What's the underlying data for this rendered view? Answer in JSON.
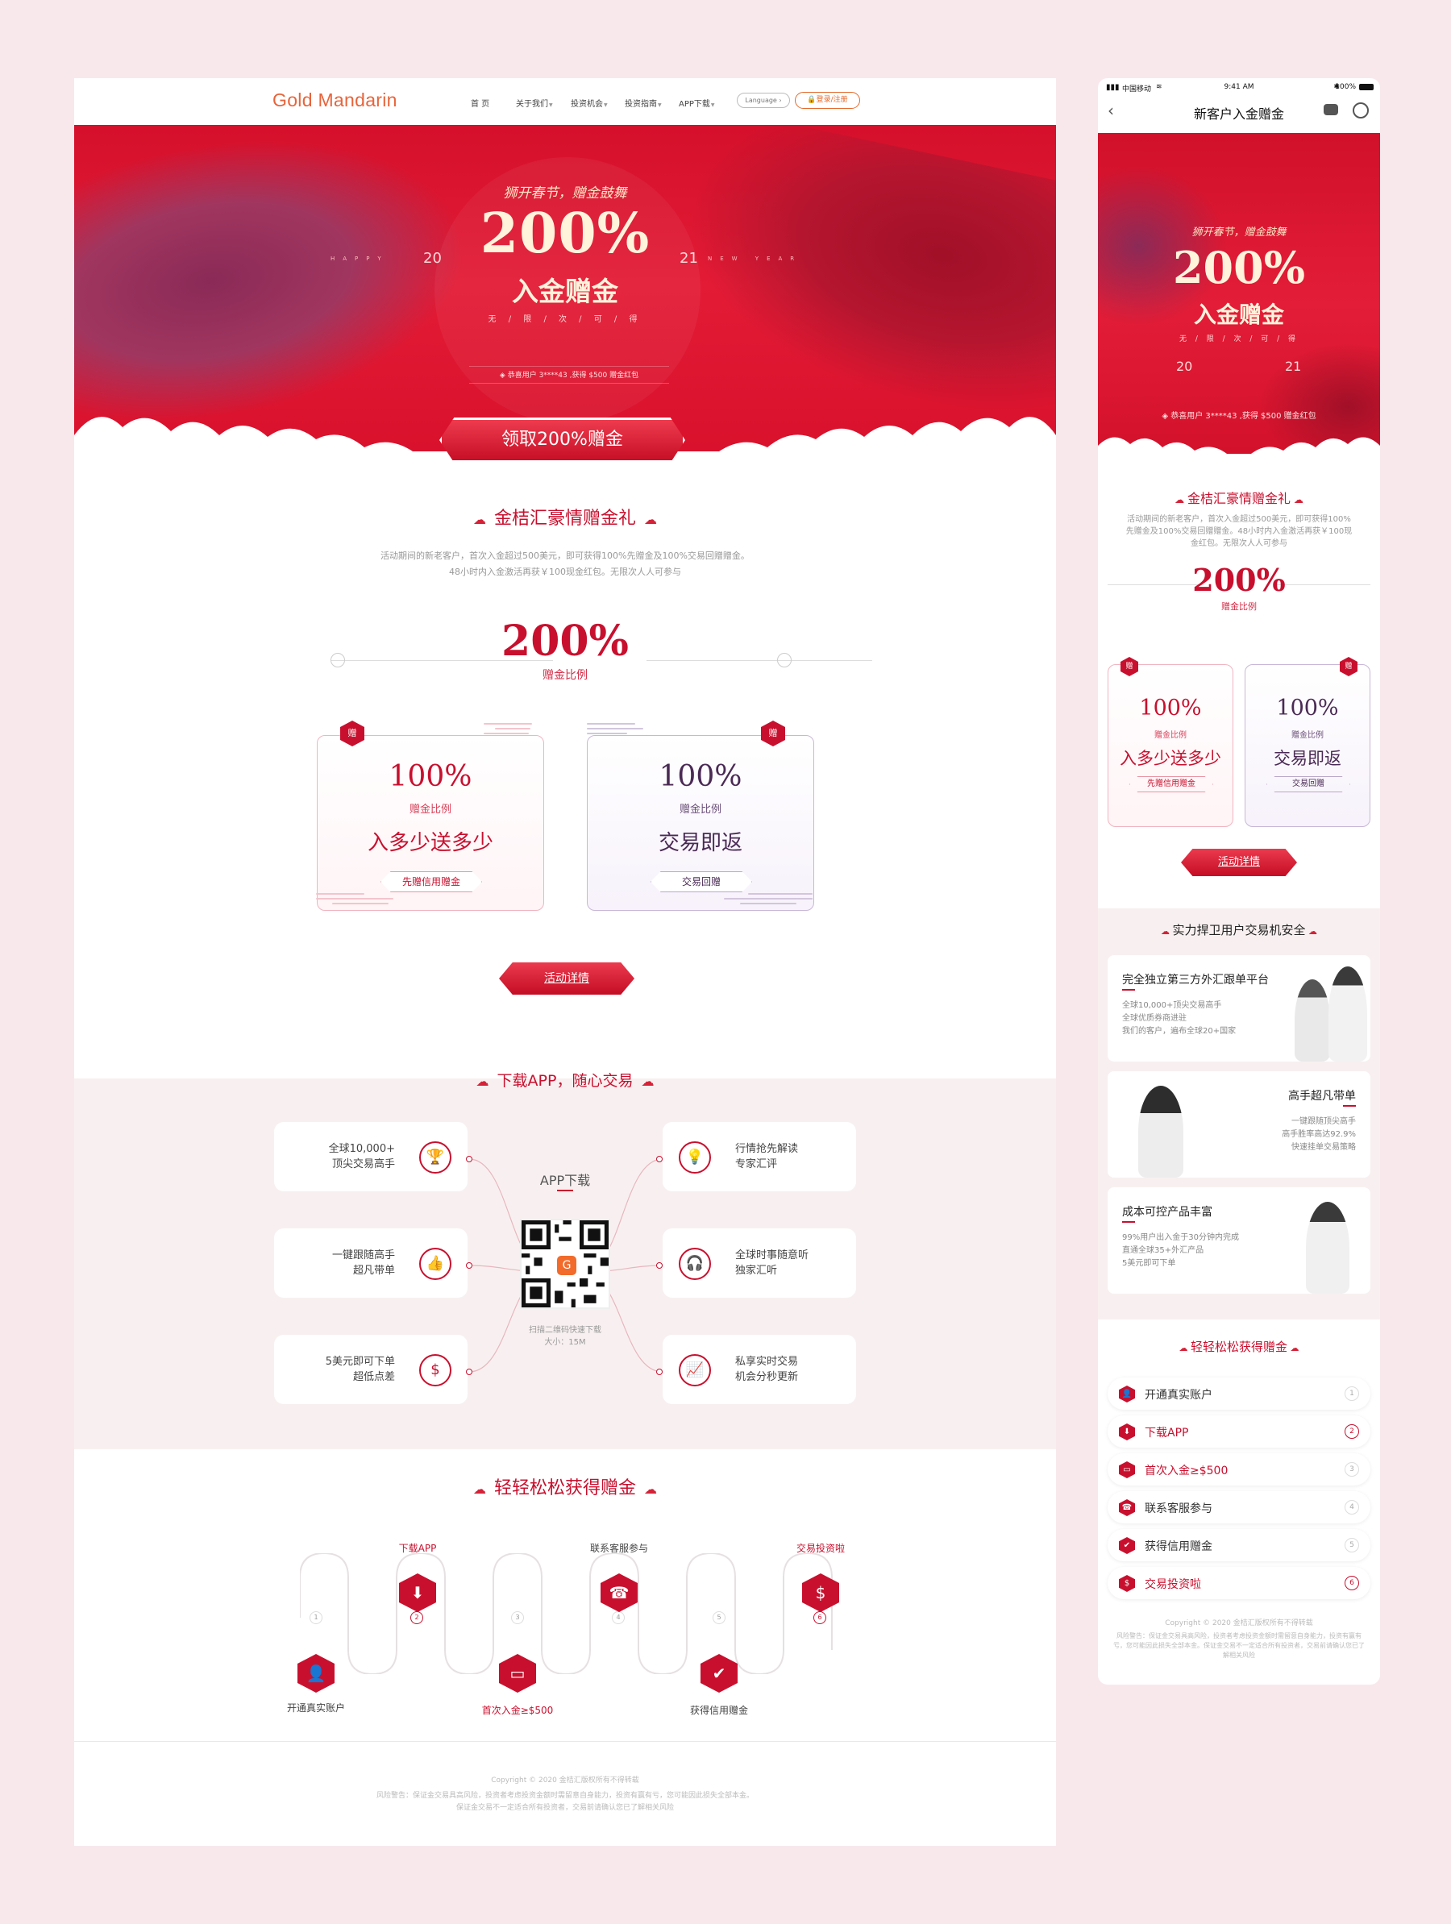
{
  "desktop": {
    "logo": "Gold Mandarin",
    "nav": [
      "首 页",
      "关于我们",
      "投资机会",
      "投资指南",
      "APP下载"
    ],
    "language": "Language",
    "login": "登录/注册",
    "hero": {
      "tagline": "狮开春节，赠金鼓舞",
      "percent": "200%",
      "title": "入金赠金",
      "subtitle": "无 / 限 / 次 / 可 / 得",
      "year_left": "20",
      "year_right": "21",
      "happy": "HAPPY",
      "new_year": "NEW YEAR",
      "notice": "恭喜用户 3****43 ,获得 $500 赠金红包",
      "cta": "领取200%赠金"
    },
    "gift": {
      "title": "金桔汇豪情赠金礼",
      "desc1": "活动期间的新老客户，首次入金超过500美元，即可获得100%先赠金及100%交易回赠赠金。",
      "desc2": "48小时内入金激活再获￥100现金红包。无限次人人可参与",
      "ratio": "200%",
      "ratio_label": "赠金比例",
      "badge": "赠",
      "cards": [
        {
          "pct": "100%",
          "ratio": "赠金比例",
          "main": "入多少送多少",
          "pill": "先赠信用赠金"
        },
        {
          "pct": "100%",
          "ratio": "赠金比例",
          "main": "交易即返",
          "pill": "交易回赠"
        }
      ],
      "detail_btn": "活动详情"
    },
    "app": {
      "title": "下载APP，随心交易",
      "qr_title": "APP下载",
      "qr_caption1": "扫描二维码快速下载",
      "qr_caption2": "大小：15M",
      "left": [
        {
          "line1": "全球10,000+",
          "line2": "顶尖交易高手",
          "icon": "trophy-icon"
        },
        {
          "line1": "一键跟随高手",
          "line2": "超凡带单",
          "icon": "thumbs-up-icon"
        },
        {
          "line1": "5美元即可下单",
          "line2": "超低点差",
          "icon": "dollar-icon"
        }
      ],
      "right": [
        {
          "line1": "行情抢先解读",
          "line2": "专家汇评",
          "icon": "lightbulb-icon"
        },
        {
          "line1": "全球时事随意听",
          "line2": "独家汇听",
          "icon": "headphones-icon"
        },
        {
          "line1": "私享实时交易",
          "line2": "机会分秒更新",
          "icon": "chart-icon"
        }
      ]
    },
    "steps": {
      "title": "轻轻松松获得赠金",
      "items": [
        {
          "n": "1",
          "label": "开通真实账户",
          "hot": false
        },
        {
          "n": "2",
          "label": "下载APP",
          "hot": true
        },
        {
          "n": "3",
          "label": "首次入金≥$500",
          "hot": true
        },
        {
          "n": "4",
          "label": "联系客服参与",
          "hot": false
        },
        {
          "n": "5",
          "label": "获得信用赠金",
          "hot": false
        },
        {
          "n": "6",
          "label": "交易投资啦",
          "hot": true
        }
      ]
    },
    "footer": {
      "copyright": "Copyright © 2020 金桔汇版权所有不得转载",
      "risk1": "风险警告：保证金交易具高风险，投资者考虑投资金额时需留意自身能力，投资有赢有亏，您可能因此损失全部本金。",
      "risk2": "保证金交易不一定适合所有投资者，交易前请确认您已了解相关风险"
    }
  },
  "mobile": {
    "status": {
      "carrier": "中国移动",
      "time": "9:41 AM",
      "battery": "100%"
    },
    "nav_title": "新客户入金赠金",
    "hero": {
      "tagline": "狮开春节，赠金鼓舞",
      "percent": "200%",
      "title": "入金赠金",
      "subtitle": "无 / 限 / 次 / 可 / 得",
      "year_left": "20",
      "year_right": "21",
      "notice": "恭喜用户 3****43 ,获得 $500 赠金红包"
    },
    "gift": {
      "title": "金桔汇豪情赠金礼",
      "desc": "活动期间的新老客户，首次入金超过500美元，即可获得100%先赠金及100%交易回赠赠金。48小时内入金激活再获￥100现金红包。无限次人人可参与",
      "ratio": "200%",
      "ratio_label": "赠金比例",
      "cards": [
        {
          "pct": "100%",
          "ratio": "赠金比例",
          "main": "入多少送多少",
          "pill": "先赠信用赠金"
        },
        {
          "pct": "100%",
          "ratio": "赠金比例",
          "main": "交易即返",
          "pill": "交易回赠"
        }
      ],
      "detail_btn": "活动详情"
    },
    "safety": {
      "title": "实力捍卫用户交易机安全",
      "panels": [
        {
          "title": "完全独立第三方外汇跟单平台",
          "desc": "全球10,000+顶尖交易高手\n全球优质券商进驻\n我们的客户，遍布全球20+国家"
        },
        {
          "title": "高手超凡带单",
          "desc": "一键跟随顶尖高手\n高手胜率高达92.9%\n快速挂单交易策略"
        },
        {
          "title": "成本可控产品丰富",
          "desc": "99%用户出入金于30分钟内完成\n直通全球35+外汇产品\n5美元即可下单"
        }
      ]
    },
    "steps": {
      "title": "轻轻松松获得赠金",
      "items": [
        {
          "n": "1",
          "label": "开通真实账户",
          "hot": false
        },
        {
          "n": "2",
          "label": "下载APP",
          "hot": true
        },
        {
          "n": "3",
          "label": "首次入金≥$500",
          "hot": true
        },
        {
          "n": "4",
          "label": "联系客服参与",
          "hot": false
        },
        {
          "n": "5",
          "label": "获得信用赠金",
          "hot": false
        },
        {
          "n": "6",
          "label": "交易投资啦",
          "hot": true
        }
      ]
    },
    "footer": {
      "copyright": "Copyright © 2020 金桔汇版权所有不得转载",
      "risk": "风险警告：保证金交易具高风险，投资者考虑投资金额时需留意自身能力，投资有赢有亏，您可能因此损失全部本金。保证金交易不一定适合所有投资者，交易前请确认您已了解相关风险"
    }
  }
}
